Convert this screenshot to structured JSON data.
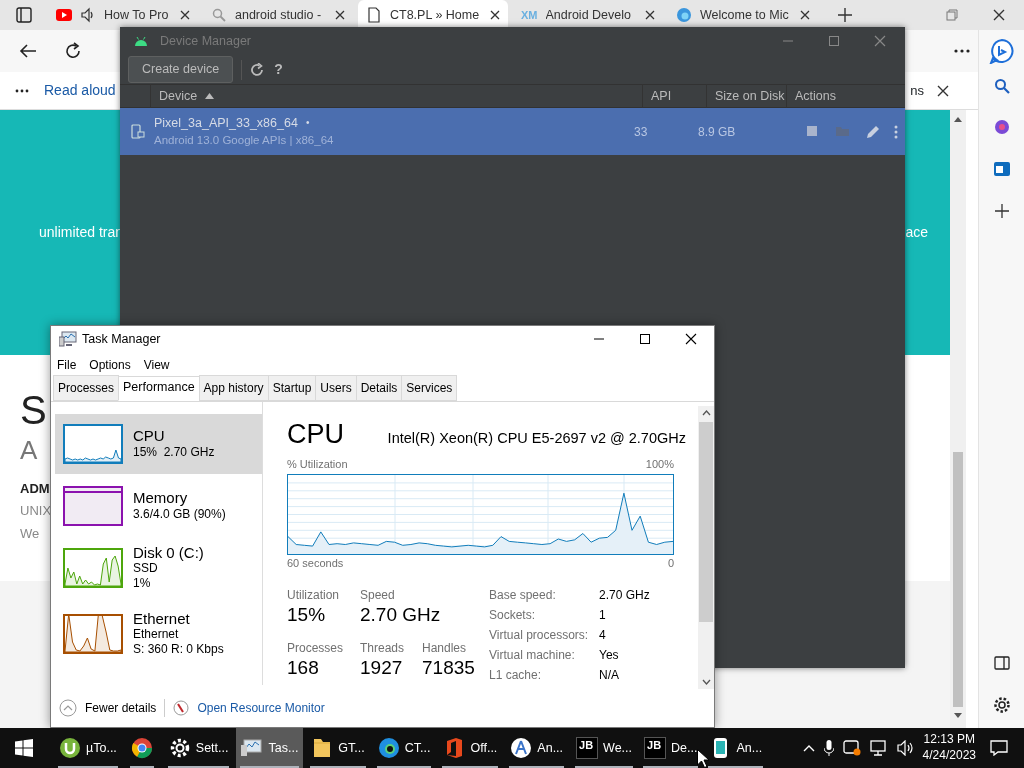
{
  "browser": {
    "tabs": [
      {
        "label": "How To Pro",
        "selected": false
      },
      {
        "label": "android studio -",
        "selected": false
      },
      {
        "label": "CT8.PL » Home",
        "selected": true
      },
      {
        "label": "Android Develo",
        "selected": false,
        "favicon_text": "XM"
      },
      {
        "label": "Welcome to Mic",
        "selected": false
      }
    ],
    "reading_bar": {
      "read_aloud": "Read aloud",
      "cut_text": "ns"
    },
    "page": {
      "banner_left": "unlimited tran",
      "banner_right": "ace",
      "heading": "S",
      "subheading": "A",
      "bold_line": "ADM",
      "line_1": "UNIX",
      "line_2": "We"
    }
  },
  "device_manager": {
    "title": "Device Manager",
    "create_button": "Create device",
    "help": "?",
    "columns": [
      "Device",
      "API",
      "Size on Disk",
      "Actions"
    ],
    "rows": [
      {
        "name": "Pixel_3a_API_33_x86_64",
        "mark": "•",
        "subtitle": "Android 13.0 Google APIs | x86_64",
        "api": "33",
        "size": "8.9 GB",
        "selected": true
      }
    ]
  },
  "task_manager": {
    "title": "Task Manager",
    "menu": [
      "File",
      "Options",
      "View"
    ],
    "tabs": [
      {
        "label": "Processes",
        "selected": false
      },
      {
        "label": "Performance",
        "selected": true
      },
      {
        "label": "App history",
        "selected": false
      },
      {
        "label": "Startup",
        "selected": false
      },
      {
        "label": "Users",
        "selected": false
      },
      {
        "label": "Details",
        "selected": false
      },
      {
        "label": "Services",
        "selected": false
      }
    ],
    "resources": [
      {
        "name": "CPU",
        "lines": [
          "15%  2.70 GHz"
        ],
        "color": "#117dbb",
        "selected": true
      },
      {
        "name": "Memory",
        "lines": [
          "3.6/4.0 GB (90%)"
        ],
        "color": "#8b12ae",
        "selected": false
      },
      {
        "name": "Disk 0 (C:)",
        "lines": [
          "SSD",
          "1%"
        ],
        "color": "#4da60c",
        "selected": false
      },
      {
        "name": "Ethernet",
        "lines": [
          "Ethernet",
          "S: 360 R: 0 Kbps"
        ],
        "color": "#a74f01",
        "selected": false
      }
    ],
    "detail": {
      "title": "CPU",
      "model": "Intel(R) Xeon(R) CPU E5-2697 v2 @ 2.70GHz",
      "graph_label": "% Utilization",
      "graph_max": "100%",
      "graph_span": "60 seconds",
      "graph_min": "0",
      "stats": [
        {
          "label": "Utilization",
          "value": "15%"
        },
        {
          "label": "Speed",
          "value": "2.70 GHz"
        },
        {
          "label": "Processes",
          "value": "168"
        },
        {
          "label": "Threads",
          "value": "1927"
        },
        {
          "label": "Handles",
          "value": "71835"
        }
      ],
      "properties": [
        {
          "label": "Base speed:",
          "value": "2.70 GHz"
        },
        {
          "label": "Sockets:",
          "value": "1"
        },
        {
          "label": "Virtual processors:",
          "value": "4"
        },
        {
          "label": "Virtual machine:",
          "value": "Yes"
        },
        {
          "label": "L1 cache:",
          "value": "N/A"
        }
      ]
    },
    "fewer_details": "Fewer details",
    "resource_monitor": "Open Resource Monitor"
  },
  "taskbar": {
    "items": [
      {
        "label": "µTo...",
        "selected": false
      },
      {
        "selected": false
      },
      {
        "label": "Sett...",
        "selected": false
      },
      {
        "label": "Tas...",
        "selected": true
      },
      {
        "label": "GT...",
        "selected": false
      },
      {
        "label": "CT...",
        "selected": false
      },
      {
        "label": "Off...",
        "selected": false
      },
      {
        "label": "An...",
        "selected": false
      },
      {
        "label": "We...",
        "selected": false,
        "icon_text": "JB"
      },
      {
        "label": "De...",
        "selected": false,
        "icon_text": "JB"
      },
      {
        "label": "An...",
        "selected": false
      }
    ],
    "time": "12:13 PM",
    "date": "4/24/2023"
  }
}
